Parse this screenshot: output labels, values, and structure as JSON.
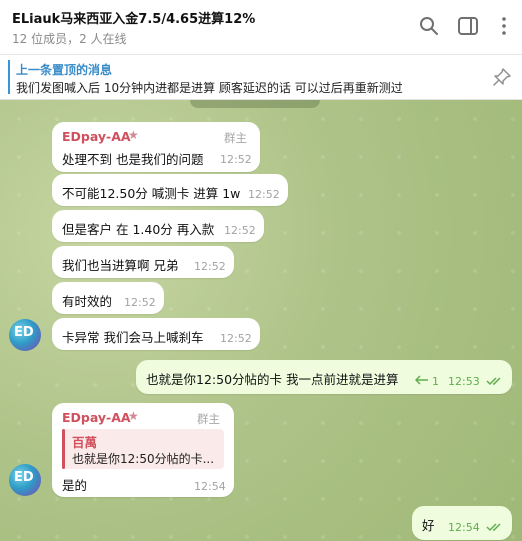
{
  "header": {
    "title": "ELiauk马来西亚入金7.5/4.65进算12%",
    "subtitle": "12 位成员，2 人在线"
  },
  "pinned": {
    "title": "上一条置顶的消息",
    "text": "我们发图喊入后 10分钟内进都是进算  顾客延迟的话 可以过后再重新测过"
  },
  "messages": [
    {
      "sender": "EDpay-AA",
      "role": "群主",
      "text": "处理不到 也是我们的问题",
      "time": "12:52"
    },
    {
      "text": "不可能12.50分 喊测卡 进算 1w",
      "time": "12:52"
    },
    {
      "text": "但是客户 在 1.40分 再入款",
      "time": "12:52"
    },
    {
      "text": "我们也当进算啊 兄弟",
      "time": "12:52"
    },
    {
      "text": "有时效的",
      "time": "12:52"
    },
    {
      "text": "卡异常 我们会马上喊刹车",
      "time": "12:52"
    },
    {
      "text": "也就是你12:50分帖的卡 我一点前进就是进算",
      "time": "12:53",
      "replies": "1"
    },
    {
      "sender": "EDpay-AA",
      "role": "群主",
      "reply_name": "百萬",
      "reply_text": "也就是你12:50分帖的卡...",
      "text": "是的",
      "time": "12:54"
    },
    {
      "text": "好",
      "time": "12:54"
    }
  ],
  "colors": {
    "sender": "#d0515d",
    "accent": "#3a8cc9",
    "outgoing": "#effdde"
  }
}
